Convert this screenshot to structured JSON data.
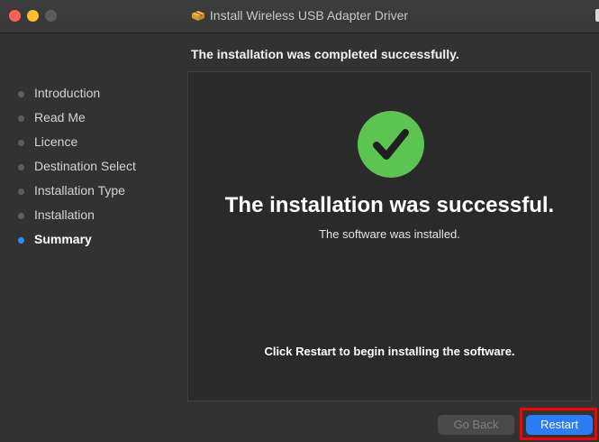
{
  "window": {
    "title": "Install Wireless USB Adapter Driver",
    "title_icon": "package-icon"
  },
  "header": {
    "text": "The installation was completed successfully."
  },
  "sidebar": {
    "items": [
      {
        "label": "Introduction",
        "active": false
      },
      {
        "label": "Read Me",
        "active": false
      },
      {
        "label": "Licence",
        "active": false
      },
      {
        "label": "Destination Select",
        "active": false
      },
      {
        "label": "Installation Type",
        "active": false
      },
      {
        "label": "Installation",
        "active": false
      },
      {
        "label": "Summary",
        "active": true
      }
    ]
  },
  "main": {
    "status_icon": "checkmark-circle-icon",
    "title": "The installation was successful.",
    "subtitle": "The software was installed.",
    "hint": "Click Restart to begin installing the software."
  },
  "buttons": {
    "go_back": "Go Back",
    "restart": "Restart"
  },
  "colors": {
    "window_bg": "#323232",
    "panel_bg": "#2a2a2a",
    "accent": "#2c7cf6",
    "success_green": "#5cc450",
    "highlight": "#ff0000"
  }
}
